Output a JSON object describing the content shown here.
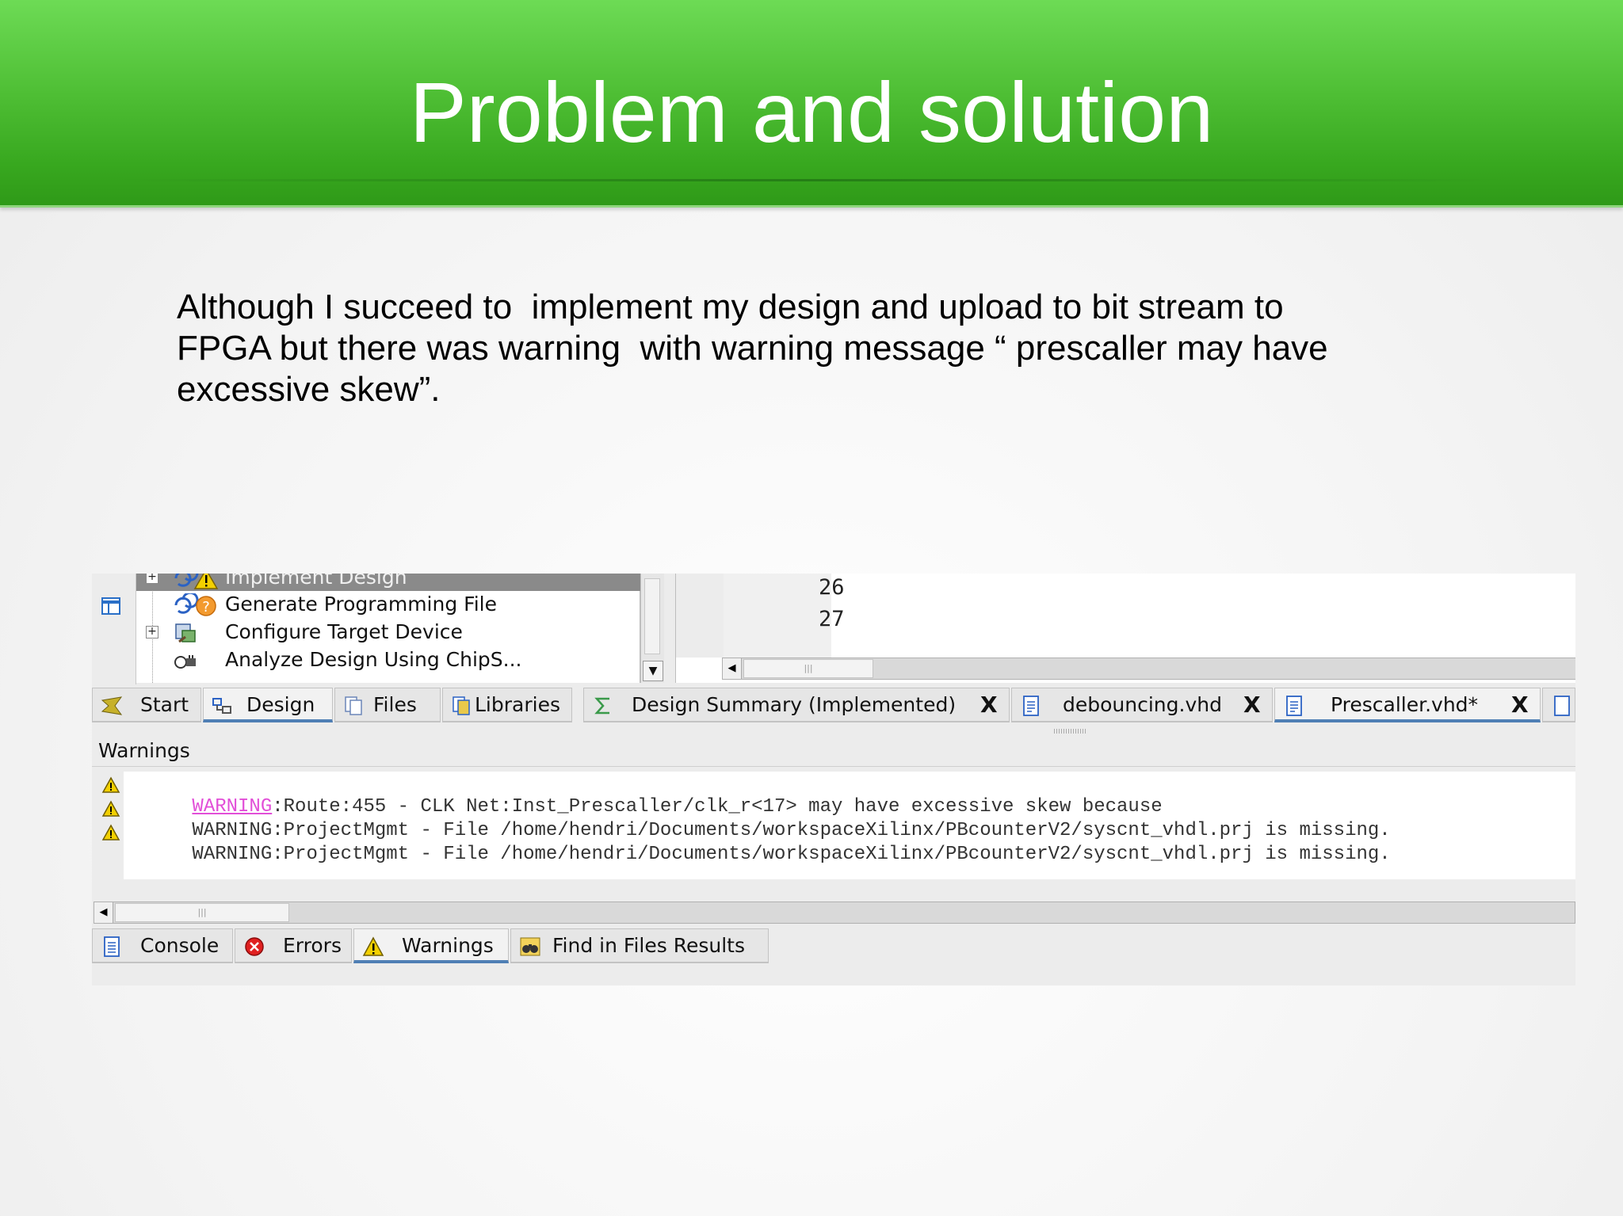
{
  "slide": {
    "title": "Problem and solution",
    "body_lines": [
      "Although I succeed to  implement my design and upload to bit stream to",
      "FPGA but there was warning  with warning message “ prescaller may have",
      "excessive skew”."
    ]
  },
  "process_tree": {
    "items": [
      {
        "label": "Implement Design",
        "icon": "warning-process-icon",
        "selected": true,
        "expandable": true
      },
      {
        "label": "Generate Programming File",
        "icon": "question-process-icon",
        "selected": false,
        "expandable": false
      },
      {
        "label": "Configure Target Device",
        "icon": "device-config-icon",
        "selected": false,
        "expandable": true
      },
      {
        "label": "Analyze Design Using ChipS...",
        "icon": "chipscope-icon",
        "selected": false,
        "expandable": false
      }
    ]
  },
  "editor": {
    "line_numbers": [
      "26",
      "27"
    ]
  },
  "left_tabs": [
    {
      "label": "Start",
      "icon": "start-arrow-icon",
      "active": false
    },
    {
      "label": "Design",
      "icon": "design-hierarchy-icon",
      "active": true
    },
    {
      "label": "Files",
      "icon": "files-icon",
      "active": false
    },
    {
      "label": "Libraries",
      "icon": "libraries-icon",
      "active": false
    }
  ],
  "editor_tabs": [
    {
      "label": "Design Summary (Implemented)",
      "icon": "sigma-icon",
      "active": false,
      "close": "X"
    },
    {
      "label": "debouncing.vhd",
      "icon": "document-icon",
      "active": false,
      "close": "X"
    },
    {
      "label": "Prescaller.vhd*",
      "icon": "document-icon",
      "active": true,
      "close": "X"
    }
  ],
  "warnings_panel": {
    "title": "Warnings",
    "lines": [
      {
        "prefix": "WARNING",
        "text": ":Route:455 - CLK Net:Inst_Prescaller/clk_r<17> may have excessive skew because",
        "highlight": true
      },
      {
        "prefix": "WARNING",
        "text": ":ProjectMgmt - File /home/hendri/Documents/workspaceXilinx/PBcounterV2/syscnt_vhdl.prj is missing.",
        "highlight": false
      },
      {
        "prefix": "WARNING",
        "text": ":ProjectMgmt - File /home/hendri/Documents/workspaceXilinx/PBcounterV2/syscnt_vhdl.prj is missing.",
        "highlight": false
      }
    ]
  },
  "bottom_tabs": [
    {
      "label": "Console",
      "icon": "console-icon",
      "active": false
    },
    {
      "label": "Errors",
      "icon": "error-icon",
      "active": false
    },
    {
      "label": "Warnings",
      "icon": "warning-icon",
      "active": true
    },
    {
      "label": "Find in Files Results",
      "icon": "binoculars-icon",
      "active": false
    }
  ],
  "colors": {
    "banner": "#4fbf35",
    "warning_link": "#e24fd8",
    "active_tab_underline": "#4f7fb5"
  }
}
